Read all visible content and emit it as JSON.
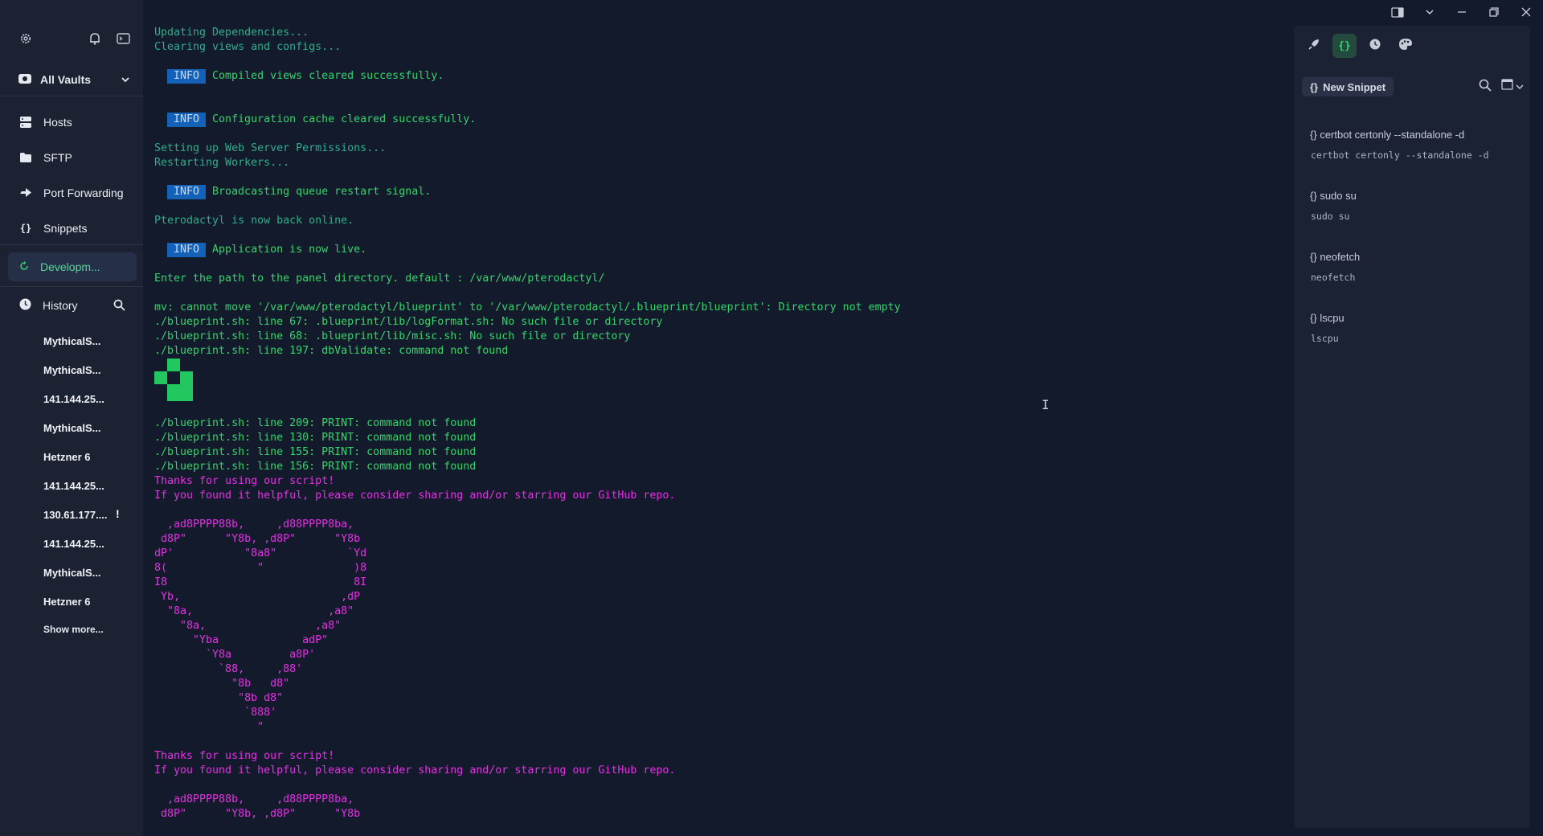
{
  "sidebar": {
    "vault_label": "All Vaults",
    "nav": [
      {
        "label": "Hosts",
        "icon": "server-icon"
      },
      {
        "label": "SFTP",
        "icon": "folder-icon"
      },
      {
        "label": "Port Forwarding",
        "icon": "forward-icon"
      },
      {
        "label": "Snippets",
        "icon": "braces-icon"
      }
    ],
    "active_tab": "Developm...",
    "history_label": "History",
    "history": [
      "MythicalS...",
      "MythicalS...",
      "141.144.25...",
      "MythicalS...",
      "Hetzner 6",
      "141.144.25...",
      "130.61.177....",
      "141.144.25...",
      "MythicalS...",
      "Hetzner 6"
    ],
    "alert_mark": "!",
    "show_more": "Show more..."
  },
  "terminal": {
    "l1": "Updating Dependencies...",
    "l2": "Clearing views and configs...",
    "info": "INFO",
    "info1": "Compiled views cleared successfully.",
    "info2": "Configuration cache cleared successfully.",
    "l3": "Setting up Web Server Permissions...",
    "l4": "Restarting Workers...",
    "info3": "Broadcasting queue restart signal.",
    "l5": "Pterodactyl is now back online.",
    "info4": "Application is now live.",
    "l6": "Enter the path to the panel directory. default : /var/www/pterodactyl/",
    "l7": "mv: cannot move '/var/www/pterodactyl/blueprint' to '/var/www/pterodactyl/.blueprint/blueprint': Directory not empty",
    "l8": "./blueprint.sh: line 67: .blueprint/lib/logFormat.sh: No such file or directory",
    "l9": "./blueprint.sh: line 68: .blueprint/lib/misc.sh: No such file or directory",
    "l10": "./blueprint.sh: line 197: dbValidate: command not found",
    "l11": "./blueprint.sh: line 209: PRINT: command not found",
    "l12": "./blueprint.sh: line 130: PRINT: command not found",
    "l13": "./blueprint.sh: line 155: PRINT: command not found",
    "l14": "./blueprint.sh: line 156: PRINT: command not found",
    "thanks": "Thanks for using our script!",
    "share": "If you found it helpful, please consider sharing and/or starring our GitHub repo.",
    "heart": [
      "  ,ad8PPPP88b,     ,d88PPPP8ba,",
      " d8P\"      \"Y8b, ,d8P\"      \"Y8b",
      "dP'           \"8a8\"           `Yd",
      "8(              \"              )8",
      "I8                             8I",
      " Yb,                         ,dP",
      "  \"8a,                     ,a8\"",
      "    \"8a,                 ,a8\"",
      "      \"Yba             adP\"",
      "        `Y8a         a8P'",
      "          `88,     ,88'",
      "            \"8b   d8\"",
      "             \"8b d8\"",
      "              `888'",
      "                \""
    ],
    "heart2": [
      "  ,ad8PPPP88b,     ,d88PPPP8ba,",
      " d8P\"      \"Y8b, ,d8P\"      \"Y8b"
    ]
  },
  "snippets": {
    "new_label": "New Snippet",
    "items": [
      {
        "title": "certbot certonly --standalone -d",
        "cmd": "certbot certonly --standalone -d"
      },
      {
        "title": "sudo su",
        "cmd": "sudo su"
      },
      {
        "title": "neofetch",
        "cmd": "neofetch"
      },
      {
        "title": "lscpu",
        "cmd": "lscpu"
      }
    ],
    "braces": "{}"
  },
  "colors": {
    "accent": "#35d36e",
    "magenta": "#e232e2",
    "info_badge": "#1461b8",
    "sidebar_bg": "#1c2232",
    "terminal_bg": "#131a2b"
  }
}
